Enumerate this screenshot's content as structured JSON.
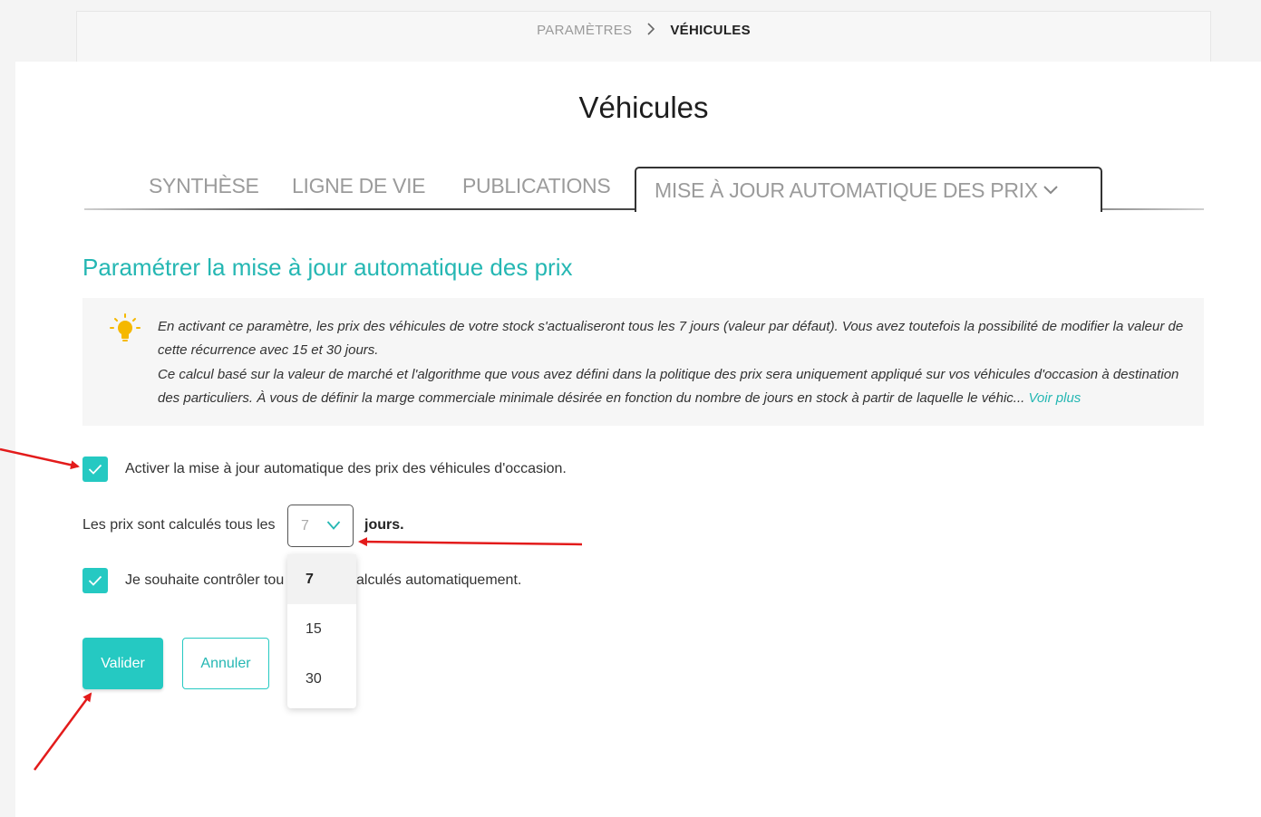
{
  "breadcrumb": {
    "parent": "PARAMÈTRES",
    "separator_icon": "chevron-right-icon",
    "current": "VÉHICULES"
  },
  "page_title": "Véhicules",
  "tabs": [
    {
      "label": "SYNTHÈSE",
      "active": false
    },
    {
      "label": "LIGNE DE VIE",
      "active": false
    },
    {
      "label": "PUBLICATIONS",
      "active": false
    },
    {
      "label": "MISE À JOUR AUTOMATIQUE DES PRIX",
      "active": true,
      "icon": "chevron-down-icon"
    }
  ],
  "section_title": "Paramétrer la mise à jour automatique des prix",
  "info": {
    "icon": "lightbulb-icon",
    "line1": "En activant ce paramètre, les prix des véhicules de votre stock s'actualiseront tous les 7 jours (valeur par défaut). Vous avez toutefois la possibilité de modifier la valeur de cette récurrence avec 15 et 30 jours.",
    "line2": "Ce calcul basé sur la valeur de marché et l'algorithme que vous avez défini dans la politique des prix sera uniquement appliqué sur vos véhicules d'occasion à destination des particuliers. À vous de définir la marge commerciale minimale désirée en fonction du nombre de jours en stock à partir de laquelle le véhic...",
    "more_link": "Voir plus"
  },
  "form": {
    "auto_update_checkbox": {
      "checked": true,
      "label": "Activer la mise à jour automatique des prix des véhicules d'occasion."
    },
    "frequency_prefix": "Les prix sont calculés tous les",
    "frequency_value": "7",
    "frequency_suffix": "jours.",
    "frequency_options": [
      "7",
      "15",
      "30"
    ],
    "control_checkbox": {
      "checked": true,
      "label_start": "Je souhaite contrôler tou",
      "label_end": "alculés automatiquement."
    }
  },
  "buttons": {
    "validate": "Valider",
    "cancel": "Annuler"
  },
  "colors": {
    "accent": "#25c9c2",
    "accent_text": "#25b7b3",
    "annotation": "#e31b1b"
  }
}
